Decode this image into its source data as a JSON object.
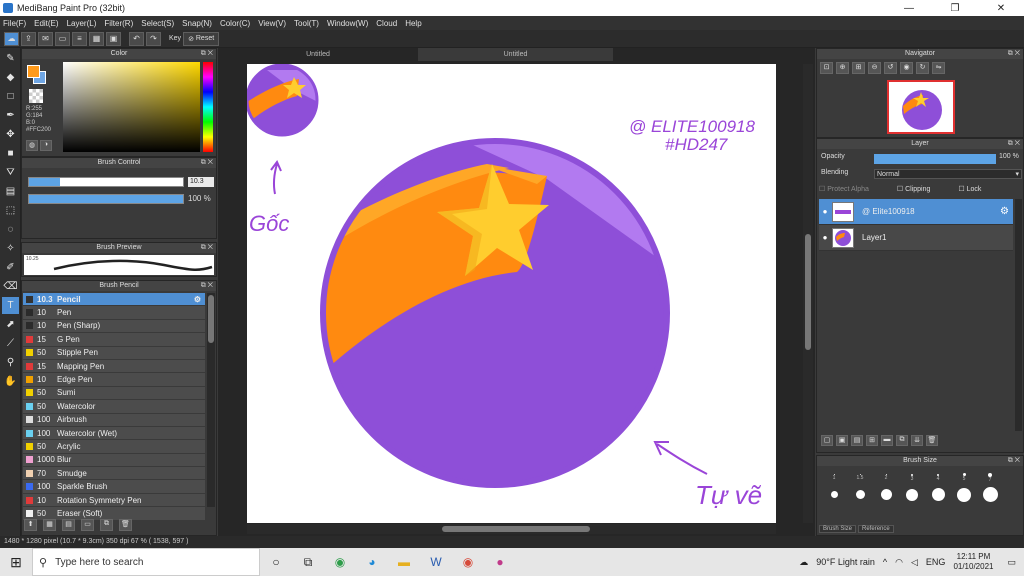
{
  "window": {
    "title": "MediBang Paint Pro (32bit)",
    "minimize": "—",
    "maximize": "❐",
    "close": "✕"
  },
  "menu": [
    "File(F)",
    "Edit(E)",
    "Layer(L)",
    "Filter(R)",
    "Select(S)",
    "Snap(N)",
    "Color(C)",
    "View(V)",
    "Tool(T)",
    "Window(W)",
    "Cloud",
    "Help"
  ],
  "toolbar": {
    "key_label": "Key",
    "reset_label": "Reset"
  },
  "color_panel": {
    "title": "Color",
    "r": "R:255",
    "g": "G:184",
    "b": "B:0",
    "hex": "#FFC200",
    "fg_color": "#ff9a1a",
    "bg_color": "#6fa6e4"
  },
  "brush_control": {
    "title": "Brush Control",
    "size_value": "10.3",
    "opacity_value": "100 %",
    "size_fraction": 0.2,
    "opacity_fraction": 1.0
  },
  "brush_preview": {
    "title": "Brush Preview",
    "size_label": "10.25"
  },
  "brush_list": {
    "title": "Brush Pencil",
    "items": [
      {
        "size": "10.3",
        "name": "Pencil",
        "color": "#333333",
        "selected": true
      },
      {
        "size": "10",
        "name": "Pen",
        "color": "#2b2b2b"
      },
      {
        "size": "10",
        "name": "Pen (Sharp)",
        "color": "#2b2b2b"
      },
      {
        "size": "15",
        "name": "G Pen",
        "color": "#e03a3a"
      },
      {
        "size": "50",
        "name": "Stipple Pen",
        "color": "#f0d000"
      },
      {
        "size": "15",
        "name": "Mapping Pen",
        "color": "#e03a3a"
      },
      {
        "size": "10",
        "name": "Edge Pen",
        "color": "#f0a000"
      },
      {
        "size": "50",
        "name": "Sumi",
        "color": "#f0d000"
      },
      {
        "size": "50",
        "name": "Watercolor",
        "color": "#6ad0f0"
      },
      {
        "size": "100",
        "name": "Airbrush",
        "color": "#dddddd"
      },
      {
        "size": "100",
        "name": "Watercolor (Wet)",
        "color": "#6ad0f0"
      },
      {
        "size": "50",
        "name": "Acrylic",
        "color": "#f0d000"
      },
      {
        "size": "1000",
        "name": "Blur",
        "color": "#f0a0d0"
      },
      {
        "size": "70",
        "name": "Smudge",
        "color": "#f0d0b0"
      },
      {
        "size": "100",
        "name": "Sparkle Brush",
        "color": "#3a6af0"
      },
      {
        "size": "10",
        "name": "Rotation Symmetry Pen",
        "color": "#e03a3a"
      },
      {
        "size": "50",
        "name": "Eraser (Soft)",
        "color": "#f0f0f0"
      }
    ]
  },
  "canvas": {
    "tabs": [
      "Untitled",
      "Untitled"
    ],
    "text_top": "@ ELITE100918",
    "text_tag": "#HD247",
    "label_corner": "Gốc",
    "label_self": "Tự vẽ",
    "colors": {
      "purple": "#8e4fd8",
      "purple_light": "#b27af0",
      "orange": "#ff8a10",
      "orange_light": "#ffa726",
      "star": "#ffcd2e",
      "annot": "#9a45d8"
    }
  },
  "navigator": {
    "title": "Navigator"
  },
  "layer_panel": {
    "title": "Layer",
    "opacity_label": "Opacity",
    "opacity_value": "100 %",
    "blending_label": "Blending",
    "blending_value": "Normal",
    "protect_alpha": "Protect Alpha",
    "clipping": "Clipping",
    "lock": "Lock",
    "layers": [
      {
        "name": "@ Elite100918",
        "selected": true
      },
      {
        "name": "Layer1",
        "selected": false
      }
    ]
  },
  "brush_size": {
    "title": "Brush Size",
    "sizes": [
      "1",
      "1.5",
      "2",
      "3",
      "4",
      "5",
      "7",
      "",
      "",
      "",
      "",
      "",
      "",
      ""
    ],
    "tabs": [
      "Brush Size",
      "Reference"
    ]
  },
  "status": "1480 * 1280 pixel  (10.7 * 9.3cm)  350 dpi  67 %  ( 1538, 597 )",
  "taskbar": {
    "search_placeholder": "Type here to search",
    "weather": "90°F  Light rain",
    "lang": "ENG",
    "time": "12:11 PM",
    "date": "01/10/2021"
  }
}
